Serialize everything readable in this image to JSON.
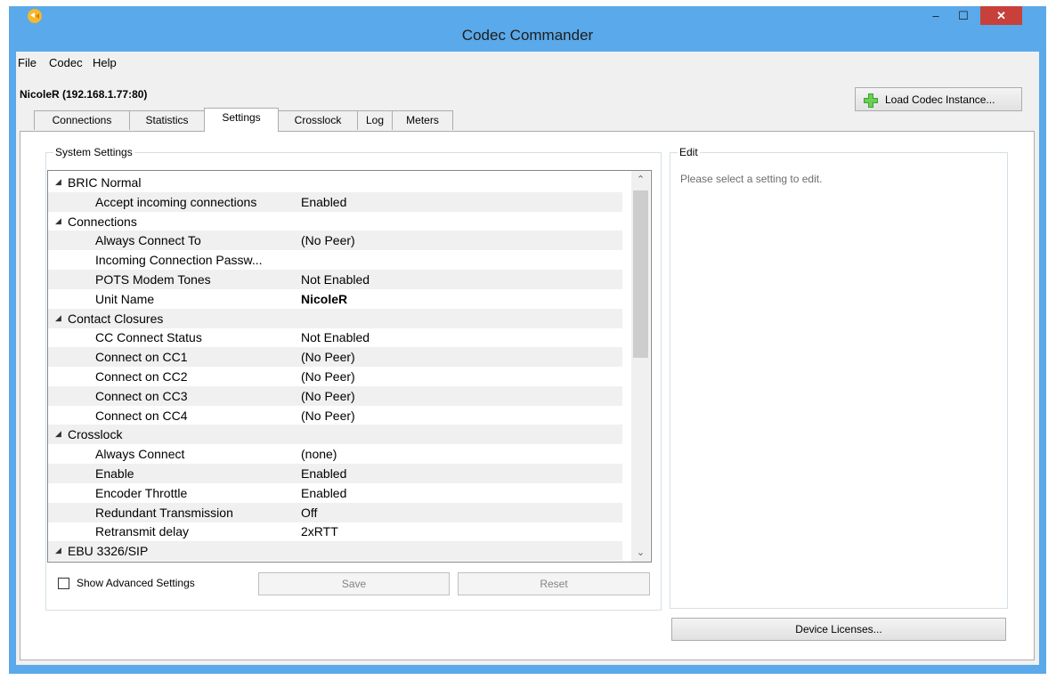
{
  "window": {
    "title": "Codec Commander",
    "minimize": "–",
    "maximize": "☐",
    "close": "✕"
  },
  "menu": [
    "File",
    "Codec",
    "Help"
  ],
  "connection_label": "NicoleR (192.168.1.77:80)",
  "load_button": "Load Codec Instance...",
  "tabs": [
    "Connections",
    "Statistics",
    "Settings",
    "Crosslock",
    "Log",
    "Meters"
  ],
  "active_tab": "Settings",
  "system_settings": {
    "title": "System Settings",
    "rows": [
      {
        "type": "category",
        "label": "BRIC Normal"
      },
      {
        "type": "item",
        "label": "Accept incoming connections",
        "value": "Enabled"
      },
      {
        "type": "category",
        "label": "Connections"
      },
      {
        "type": "item",
        "label": "Always Connect To",
        "value": "(No Peer)"
      },
      {
        "type": "item",
        "label": "Incoming Connection Passw...",
        "value": ""
      },
      {
        "type": "item",
        "label": "POTS Modem Tones",
        "value": "Not Enabled"
      },
      {
        "type": "item",
        "label": "Unit Name",
        "value": "NicoleR",
        "bold": true
      },
      {
        "type": "category",
        "label": "Contact Closures"
      },
      {
        "type": "item",
        "label": "CC Connect Status",
        "value": "Not Enabled"
      },
      {
        "type": "item",
        "label": "Connect on CC1",
        "value": "(No Peer)"
      },
      {
        "type": "item",
        "label": "Connect on CC2",
        "value": "(No Peer)"
      },
      {
        "type": "item",
        "label": "Connect on CC3",
        "value": "(No Peer)"
      },
      {
        "type": "item",
        "label": "Connect on CC4",
        "value": "(No Peer)"
      },
      {
        "type": "category",
        "label": "Crosslock"
      },
      {
        "type": "item",
        "label": "Always Connect",
        "value": "(none)"
      },
      {
        "type": "item",
        "label": "Enable",
        "value": "Enabled"
      },
      {
        "type": "item",
        "label": "Encoder Throttle",
        "value": "Enabled"
      },
      {
        "type": "item",
        "label": "Redundant Transmission",
        "value": "Off"
      },
      {
        "type": "item",
        "label": "Retransmit delay",
        "value": "2xRTT"
      },
      {
        "type": "category",
        "label": "EBU 3326/SIP"
      }
    ],
    "show_advanced": "Show Advanced Settings",
    "save": "Save",
    "reset": "Reset"
  },
  "edit": {
    "title": "Edit",
    "hint": "Please select a setting to edit."
  },
  "device_licenses": "Device Licenses...",
  "colors": {
    "title_bar": "#5aa9ea",
    "close_button": "#c7403a",
    "alt_row": "#f0f0f0"
  }
}
